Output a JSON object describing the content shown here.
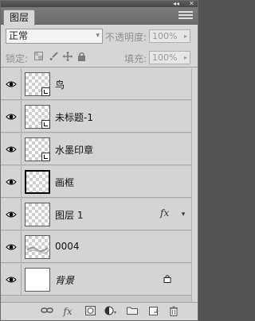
{
  "window": {
    "collapse_glyph": "◂◂",
    "close_glyph": "✕"
  },
  "tab": {
    "label": "图层",
    "menu_icon": "panel-menu-icon"
  },
  "blend_mode": {
    "value": "正常",
    "arrow": "▾"
  },
  "opacity": {
    "label": "不透明度:",
    "value": "100%",
    "arrow": "▸"
  },
  "lock": {
    "label": "锁定:",
    "icons": [
      "lock-transparent-icon",
      "lock-paint-icon",
      "lock-move-icon",
      "lock-all-icon"
    ]
  },
  "fill": {
    "label": "填充:",
    "value": "100%",
    "arrow": "▸"
  },
  "layers": [
    {
      "name": "鸟",
      "thumb": "transparent",
      "smart": true
    },
    {
      "name": "未标题-1",
      "thumb": "transparent",
      "smart": true
    },
    {
      "name": "水墨印章",
      "thumb": "transparent",
      "smart": true
    },
    {
      "name": "画框",
      "thumb": "frame",
      "smart": false
    },
    {
      "name": "图层 1",
      "thumb": "transparent",
      "smart": false,
      "fx": "fx",
      "expand": "▾"
    },
    {
      "name": "0004",
      "thumb": "transparent-sketch",
      "smart": false
    },
    {
      "name": "背景",
      "thumb": "white",
      "smart": false,
      "locked": true
    }
  ],
  "footer_icons": [
    "link-icon",
    "fx-icon",
    "mask-icon",
    "adjustment-icon",
    "folder-icon",
    "new-layer-icon",
    "trash-icon"
  ],
  "footer_fx": "fx"
}
